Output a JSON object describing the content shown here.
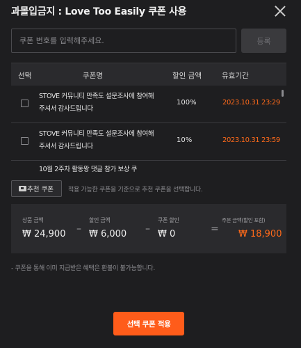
{
  "header": {
    "title": "과몰입금지 : Love Too Easily 쿠폰 사용"
  },
  "input": {
    "placeholder": "쿠폰 번호를 입력해주세요.",
    "value": "",
    "register_label": "등록"
  },
  "table": {
    "headers": {
      "select": "선택",
      "name": "쿠폰명",
      "amount": "할인 금액",
      "period": "유효기간"
    },
    "rows": [
      {
        "name": "STOVE 커뮤니티 만족도 설문조사에 참여해 주셔서 감사드립니다",
        "amount": "100%",
        "period": "2023.10.31 23:29"
      },
      {
        "name": "STOVE 커뮤니티 만족도 설문조사에 참여해 주셔서 감사드립니다",
        "amount": "10%",
        "period": "2023.10.31 23:59"
      },
      {
        "name": "10월 2주차 활동왕 댓글 참가 보상 쿠",
        "amount": "",
        "period": ""
      }
    ]
  },
  "recommend": {
    "button_label": "추천 쿠폰",
    "icon": "ticket-icon",
    "description": "적용 가능한 쿠폰을 기준으로 추천 쿠폰을 선택합니다."
  },
  "summary": {
    "product_label": "상품 금액",
    "product_value": "₩ 24,900",
    "discount_label": "할인 금액",
    "discount_value": "₩ 6,000",
    "coupon_label": "쿠폰 할인",
    "coupon_value": "₩ 0",
    "order_label": "주문 금액(할인 포함)",
    "order_value": "₩ 18,900",
    "op_minus": "–",
    "op_equals": "="
  },
  "notice": "- 쿠폰을 통해 이미 지급받은 혜택은 환불이 불가능합니다.",
  "apply_button": "선택 쿠폰 적용",
  "colors": {
    "accent": "#ff5c1a",
    "period_text": "#ff6a1a",
    "background": "#1e1e20",
    "panel": "#2a2a2d"
  }
}
